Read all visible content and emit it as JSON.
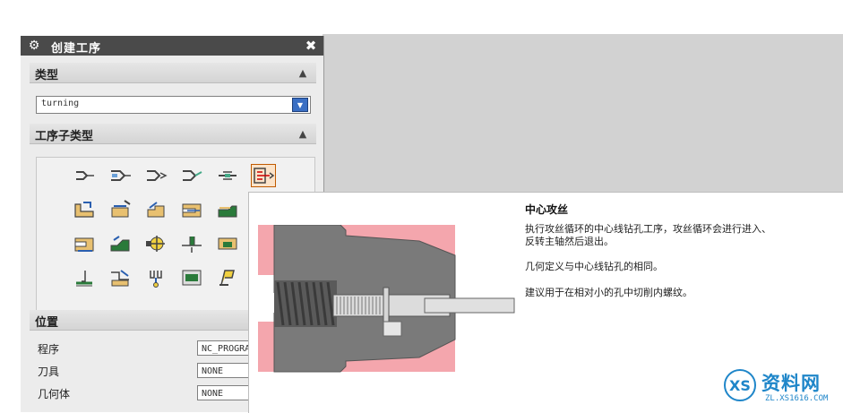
{
  "dialog": {
    "title": "创建工序",
    "gear_icon": "gear-icon",
    "close_glyph": "✖",
    "type_section": {
      "label": "类型",
      "collapse_glyph": "▲",
      "selected": "turning"
    },
    "subtype_section": {
      "label": "工序子类型",
      "collapse_glyph": "▲"
    },
    "position_section": {
      "label": "位置",
      "fields": [
        {
          "label": "程序",
          "value": "NC_PROGRAM"
        },
        {
          "label": "刀具",
          "value": "NONE"
        },
        {
          "label": "几何体",
          "value": "NONE"
        }
      ]
    }
  },
  "subtype_icons": [
    "centerline-spotdrill-icon",
    "centerline-drilling-icon",
    "centerline-peckdrill-icon",
    "centerline-breakchip-icon",
    "centerline-ream-icon",
    "centerline-tapping-icon",
    "facing-icon",
    "rough-turn-od-icon",
    "rough-back-turn-icon",
    "rough-bore-id-icon",
    "finish-turn-od-icon",
    "finish-bore-id-icon",
    "back-finish-icon",
    "teach-mode-icon",
    "groove-od-icon",
    "groove-id-icon",
    "thread-od-icon",
    "thread-id-icon",
    "parting-icon",
    "user-defined-icon",
    "probe-icon"
  ],
  "tooltip": {
    "title": "中心攻丝",
    "desc1_line1": "执行攻丝循环的中心线钻孔工序，攻丝循环会进行进入、",
    "desc1_line2": "反转主轴然后退出。",
    "desc2": "几何定义与中心线钻孔的相同。",
    "desc3": "建议用于在相对小的孔中切削内螺纹。"
  },
  "watermark": {
    "brand": "资料网",
    "url": "ZL.XS1616.COM",
    "logo_text": "XS"
  },
  "colors": {
    "accent_selected": "#f7d6b2",
    "dropdown_arrow": "#3a6fc4",
    "part_gray": "#7a7a7a",
    "stock_pink": "#f4a6ad",
    "watermark_blue": "#1f86c9"
  }
}
